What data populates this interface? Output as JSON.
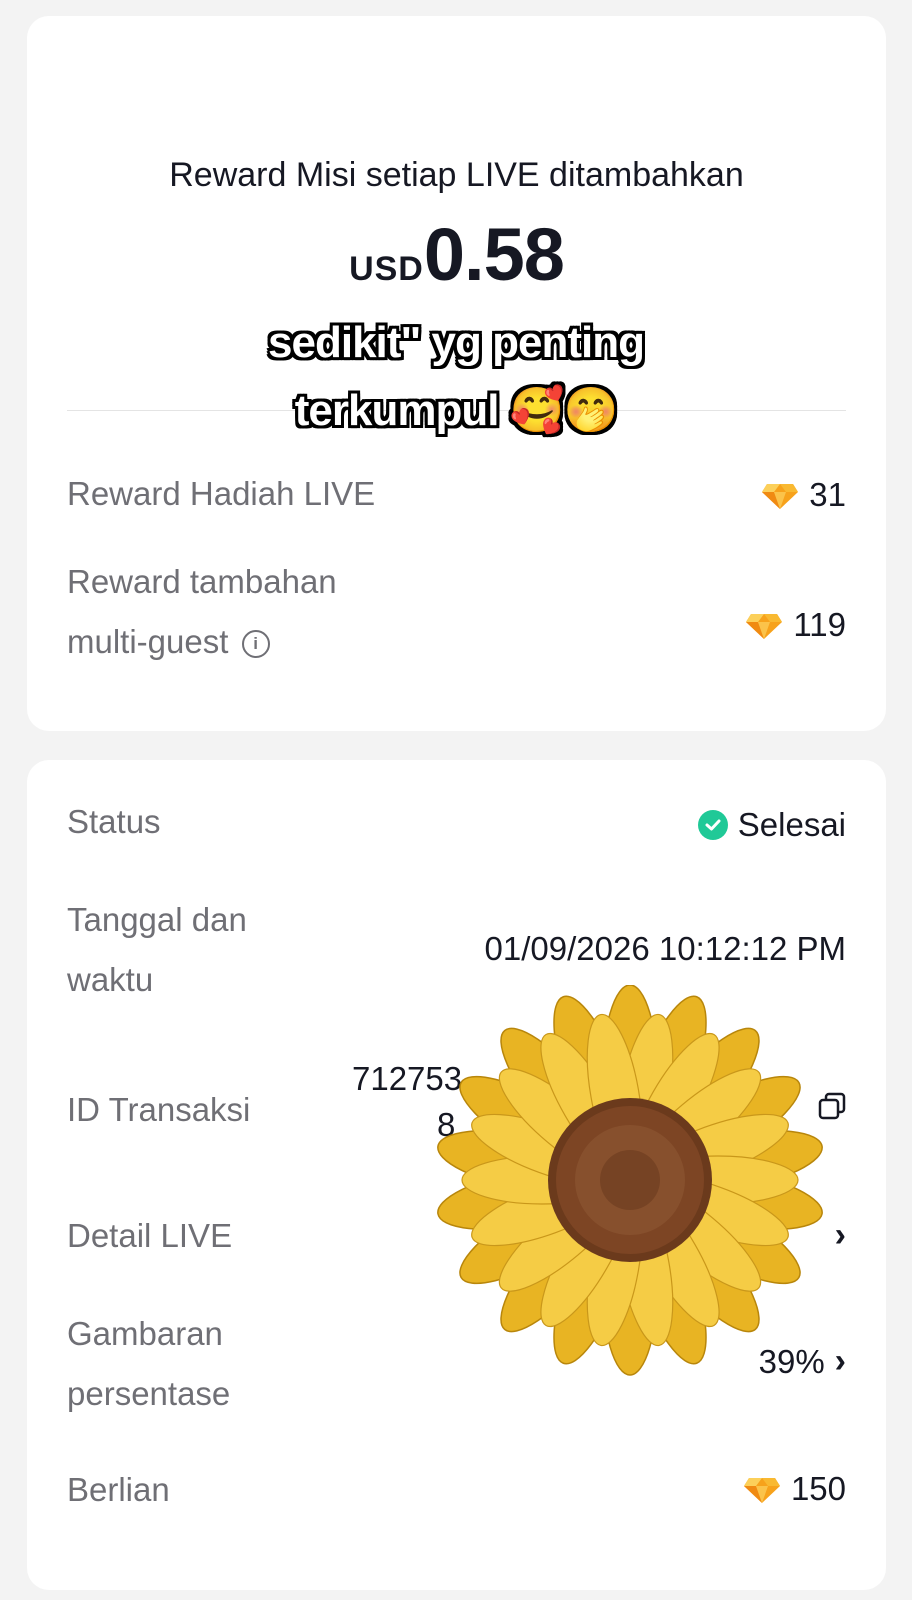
{
  "mission_card": {
    "headline": "Reward Misi setiap LIVE ditambahkan",
    "currency": "USD",
    "amount": "0.58",
    "rows": [
      {
        "label": "Reward Hadiah LIVE",
        "value": "31",
        "icon": "diamond-icon"
      },
      {
        "label_line1": "Reward tambahan",
        "label_line2": "multi-guest",
        "value": "119",
        "icon": "diamond-icon",
        "info_icon": "ⓘ"
      }
    ]
  },
  "overlay": {
    "caption_line1": "sedikit\" yg penting",
    "caption_line2": "terkumpul 🥰🤭"
  },
  "details_card": {
    "status_label": "Status",
    "status_value": "Selesai",
    "datetime_label_line1": "Tanggal dan",
    "datetime_label_line2": "waktu",
    "datetime_value": "01/09/2026 10:12:12 PM",
    "transaction_label": "ID Transaksi",
    "transaction_value_line1": "712753",
    "transaction_value_line2": "8",
    "live_detail_label": "Detail LIVE",
    "overview_label_line1": "Gambaran",
    "overview_label_line2": "persentase",
    "overview_value": "39%",
    "diamond_label": "Berlian",
    "diamond_value": "150"
  },
  "colors": {
    "accent_diamond": "#f7a21b",
    "status_green": "#20c997",
    "text_primary": "#161823",
    "text_secondary": "#6f6f75"
  }
}
